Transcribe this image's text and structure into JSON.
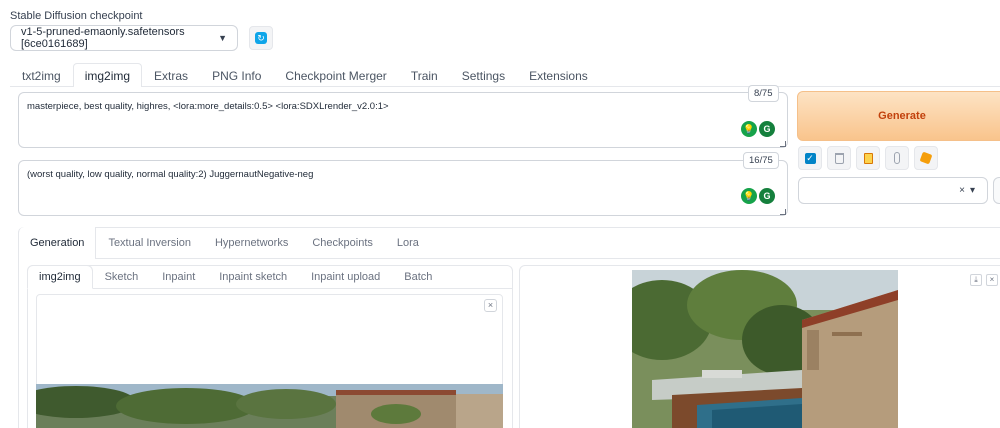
{
  "checkpoint": {
    "label": "Stable Diffusion checkpoint",
    "value": "v1-5-pruned-emaonly.safetensors [6ce0161689]",
    "refresh_icon": "refresh-icon"
  },
  "top_tabs": [
    {
      "label": "txt2img",
      "active": false
    },
    {
      "label": "img2img",
      "active": true
    },
    {
      "label": "Extras",
      "active": false
    },
    {
      "label": "PNG Info",
      "active": false
    },
    {
      "label": "Checkpoint Merger",
      "active": false
    },
    {
      "label": "Train",
      "active": false
    },
    {
      "label": "Settings",
      "active": false
    },
    {
      "label": "Extensions",
      "active": false
    }
  ],
  "prompt": {
    "positive": "masterpiece, best quality, highres, <lora:more_details:0.5> <lora:SDXLrender_v2.0:1>",
    "positive_counter": "8/75",
    "negative": "(worst quality, low quality, normal quality:2) JuggernautNegative-neg",
    "negative_counter": "16/75"
  },
  "generate": {
    "label": "Generate",
    "color": "#c2410c"
  },
  "tool_icons": [
    "checkbox-icon",
    "trash-icon",
    "clipboard-icon",
    "paperclip-icon",
    "package-icon"
  ],
  "style_select": {
    "clear_symbol": "×",
    "caret": "▾"
  },
  "gen_tabs": [
    {
      "label": "Generation",
      "active": true
    },
    {
      "label": "Textual Inversion",
      "active": false
    },
    {
      "label": "Hypernetworks",
      "active": false
    },
    {
      "label": "Checkpoints",
      "active": false
    },
    {
      "label": "Lora",
      "active": false
    }
  ],
  "sub_tabs": [
    {
      "label": "img2img",
      "active": true
    },
    {
      "label": "Sketch",
      "active": false
    },
    {
      "label": "Inpaint",
      "active": false
    },
    {
      "label": "Inpaint sketch",
      "active": false
    },
    {
      "label": "Inpaint upload",
      "active": false
    },
    {
      "label": "Batch",
      "active": false
    }
  ],
  "canvas": {
    "close_symbol": "×"
  },
  "output": {
    "download_symbol": "⤓",
    "close_symbol": "×"
  }
}
